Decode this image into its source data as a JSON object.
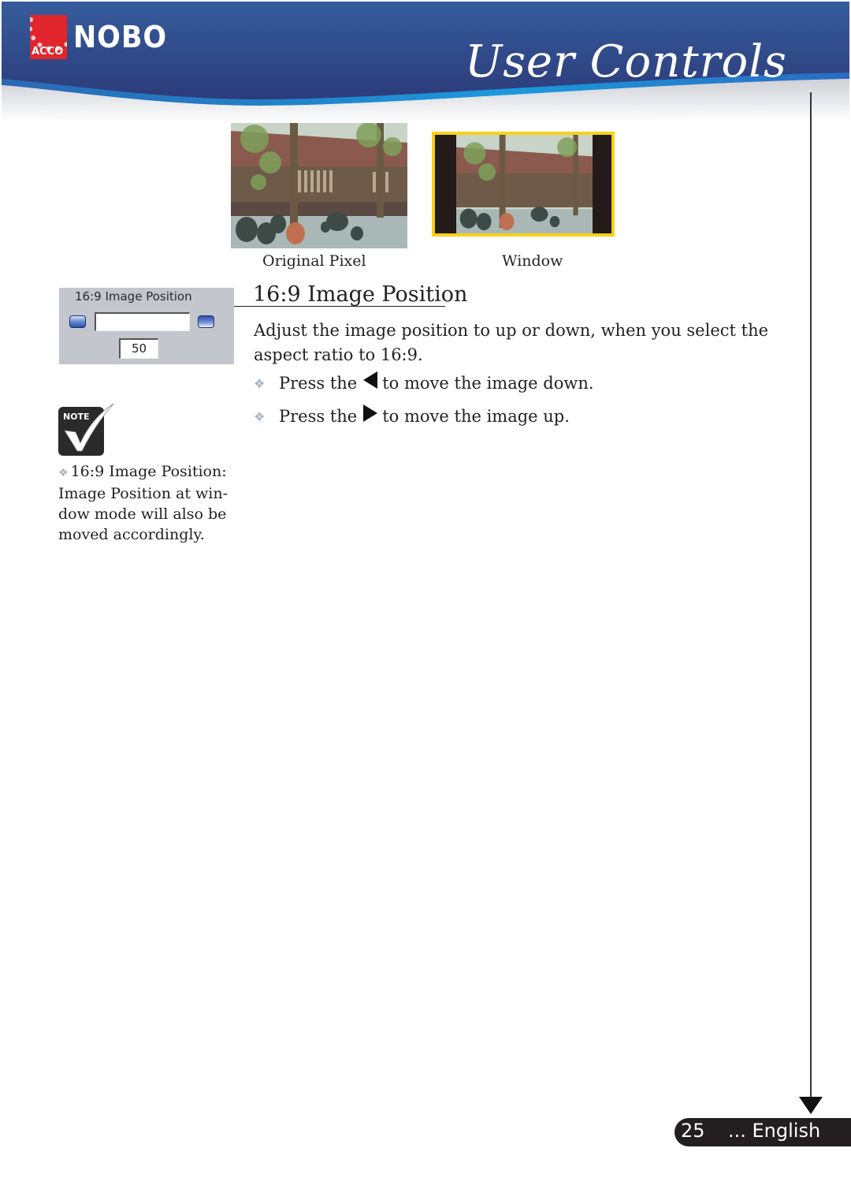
{
  "header": {
    "brand_parent": "ACCO",
    "brand": "NOBO",
    "page_title": "User Controls",
    "colors": {
      "banner_dark": "#2b3f7e",
      "banner_light": "#3a64a8",
      "accent_stripe": "#1d8ed8",
      "acco_red": "#e0262c"
    }
  },
  "figures": {
    "original": {
      "caption": "Original Pixel",
      "icon": "photo-scene"
    },
    "window": {
      "caption": "Window",
      "icon": "photo-scene-windowed",
      "frame_color": "#f7d21a"
    }
  },
  "osd": {
    "title": "16:9 Image Position",
    "value": "50",
    "decrease_icon": "left-pill-button",
    "increase_icon": "right-pill-button"
  },
  "section": {
    "title": "16:9 Image Position",
    "description": "Adjust the image position to up or down, when you select the aspect ratio to 16:9.",
    "bullets": [
      {
        "prefix": "Press the",
        "key_icon": "left-triangle",
        "suffix": "to move the image down."
      },
      {
        "prefix": "Press the",
        "key_icon": "right-triangle",
        "suffix": "to move the image up."
      }
    ]
  },
  "note": {
    "icon_label": "NOTE",
    "text": "16:9 Image Position: Image Position at win- dow mode will also be moved accordingly."
  },
  "footer": {
    "page_number": "25",
    "language": "... English"
  }
}
